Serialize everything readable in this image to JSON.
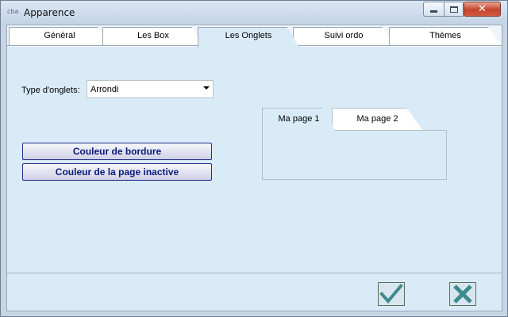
{
  "window": {
    "title": "Apparence",
    "app_icon_text": "cba"
  },
  "tabs": [
    {
      "label": "Général",
      "active": false
    },
    {
      "label": "Les Box",
      "active": false
    },
    {
      "label": "Les Onglets",
      "active": true
    },
    {
      "label": "Suivi ordo",
      "active": false
    },
    {
      "label": "Thèmes",
      "active": false
    }
  ],
  "settings": {
    "type_label": "Type d'onglets:",
    "type_value": "Arrondi",
    "border_color_button": "Couleur de bordure",
    "inactive_page_color_button": "Couleur de la page inactive"
  },
  "preview": {
    "tabs": [
      "Ma page 1",
      "Ma page 2"
    ]
  },
  "colors": {
    "accent_check": "#3f8a8d",
    "accent_cancel": "#3f8a8d",
    "client_bg": "#d9ebf7"
  },
  "icons": {
    "ok": "checkmark-icon",
    "cancel": "x-icon"
  }
}
